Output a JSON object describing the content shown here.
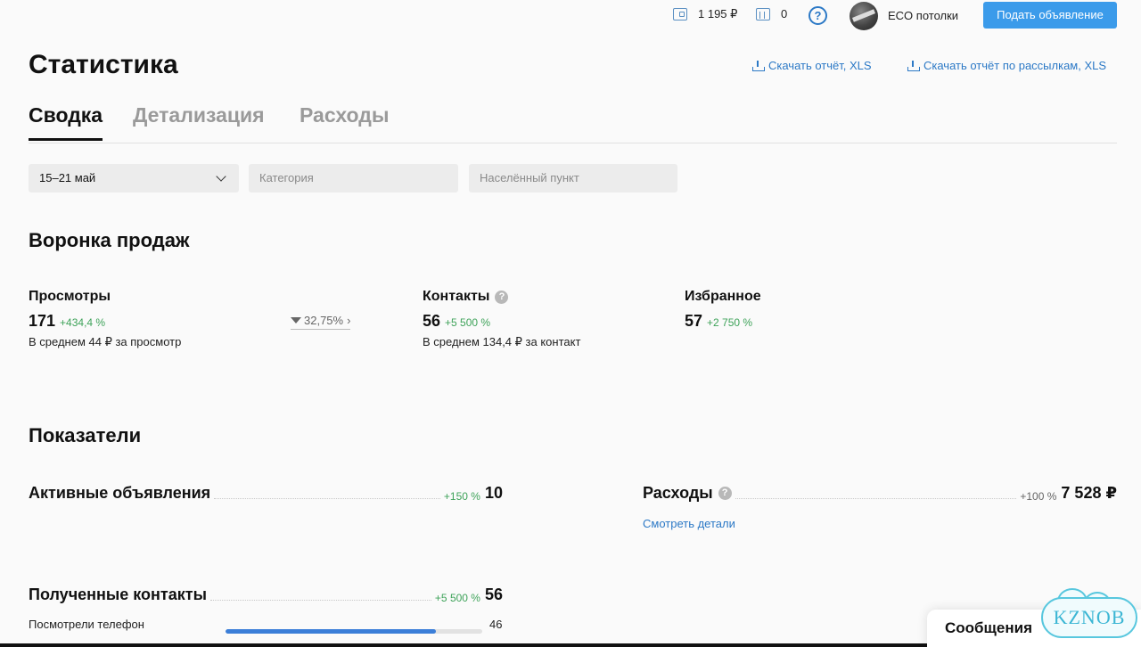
{
  "topbar": {
    "balance": "1 195 ₽",
    "promo_count": "0",
    "help": "?",
    "profile_name": "ECO потолки",
    "post_button": "Подать объявление"
  },
  "header": {
    "title": "Статистика",
    "download_report": "Скачать отчёт, XLS",
    "download_mailing_report": "Скачать отчёт по рассылкам, XLS"
  },
  "tabs": [
    {
      "label": "Сводка",
      "active": true
    },
    {
      "label": "Детализация",
      "active": false
    },
    {
      "label": "Расходы",
      "active": false
    }
  ],
  "filters": {
    "period": "15–21 май",
    "category_placeholder": "Категория",
    "location_placeholder": "Населённый пункт"
  },
  "funnel": {
    "title": "Воронка продаж",
    "views": {
      "label": "Просмотры",
      "value": "171",
      "delta": "+434,4 %",
      "sub": "В среднем 44 ₽ за просмотр"
    },
    "conversion": "32,75%",
    "contacts": {
      "label": "Контакты",
      "value": "56",
      "delta": "+5 500 %",
      "sub": "В среднем 134,4 ₽ за контакт"
    },
    "favorites": {
      "label": "Избранное",
      "value": "57",
      "delta": "+2 750 %"
    }
  },
  "indicators": {
    "title": "Показатели",
    "active_ads": {
      "label": "Активные объявления",
      "delta": "+150 %",
      "value": "10"
    },
    "expenses": {
      "label": "Расходы",
      "delta": "+100 %",
      "value": "7 528 ₽",
      "details_link": "Смотреть детали"
    },
    "received_contacts": {
      "label": "Полученные контакты",
      "delta": "+5 500 %",
      "value": "56"
    },
    "phone_views": {
      "label": "Посмотрели телефон",
      "value": "46",
      "fraction": 0.82
    }
  },
  "messages_panel": {
    "label": "Сообщения"
  },
  "watermark": {
    "text": "KZNOB"
  },
  "colors": {
    "accent": "#2c79c6",
    "button": "#3b9bea",
    "positive": "#3fa35a",
    "progress": "#3b7ed8"
  }
}
